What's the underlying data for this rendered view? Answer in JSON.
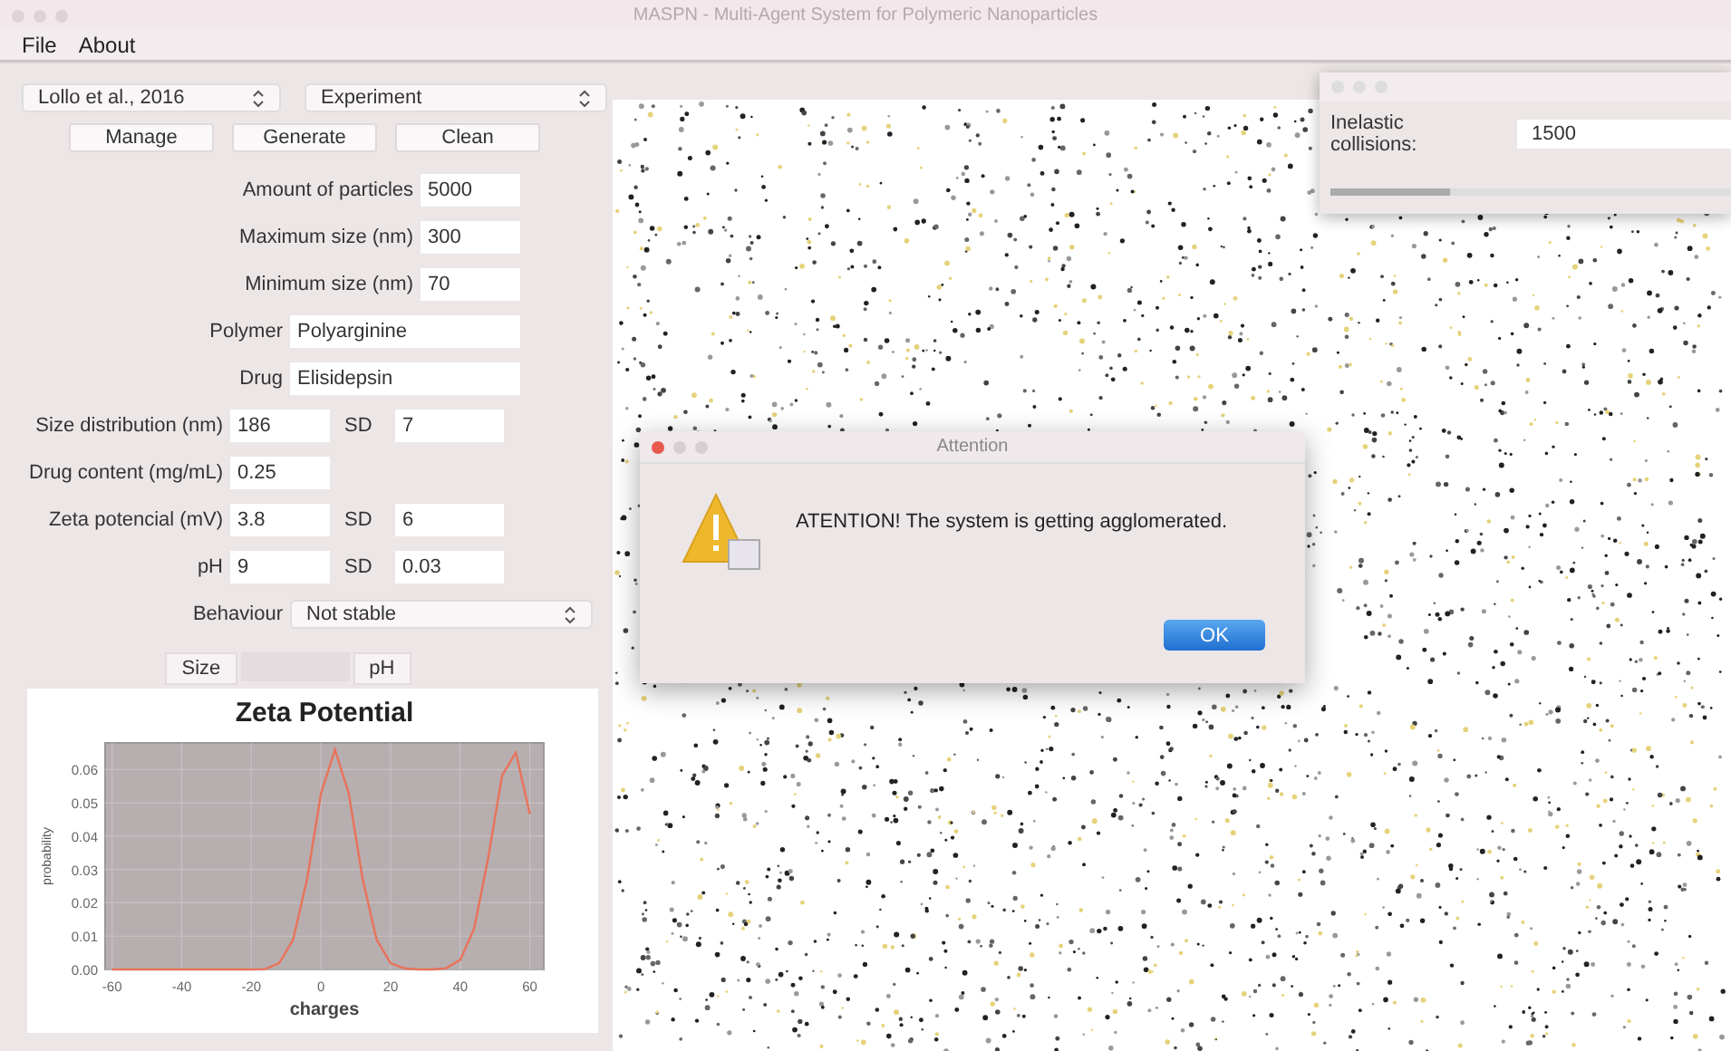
{
  "window": {
    "title": "MASPN - Multi-Agent System for Polymeric Nanoparticles"
  },
  "menu": [
    "File",
    "About"
  ],
  "left_panel": {
    "selectors": [
      {
        "value": "Lollo et al., 2016"
      },
      {
        "value": "Experiment"
      }
    ],
    "buttons": [
      "Manage",
      "Generate",
      "Clean"
    ],
    "fields": [
      {
        "kind": "number",
        "label": "Amount of particles",
        "value": "5000"
      },
      {
        "kind": "number",
        "label": "Maximum size (nm)",
        "value": "300"
      },
      {
        "kind": "number",
        "label": "Minimum size (nm)",
        "value": "70"
      },
      {
        "kind": "text",
        "label": "Polymer",
        "value": "Polyarginine"
      },
      {
        "kind": "text",
        "label": "Drug",
        "value": "Elisidepsin"
      },
      {
        "kind": "pair",
        "label": "Size distribution (nm)",
        "value": "186",
        "sd_label": "SD",
        "sd_value": "7"
      },
      {
        "kind": "single",
        "label": "Drug content (mg/mL)",
        "value": "0.25"
      },
      {
        "kind": "pair",
        "label": "Zeta potencial (mV)",
        "value": "3.8",
        "sd_label": "SD",
        "sd_value": "6"
      },
      {
        "kind": "pair",
        "label": "pH",
        "value": "9",
        "sd_label": "SD",
        "sd_value": "0.03"
      },
      {
        "kind": "select",
        "label": "Behaviour",
        "value": "Not stable"
      }
    ],
    "tabs": [
      {
        "label": "Size",
        "selected": false
      },
      {
        "selected": true
      },
      {
        "label": "pH",
        "selected": false
      }
    ],
    "chart": {
      "chart_data": {
        "type": "line",
        "title": "Zeta Potential",
        "xlabel": "charges",
        "ylabel": "probability",
        "x": [
          -60,
          -56,
          -52,
          -48,
          -44,
          -40,
          -36,
          -32,
          -28,
          -24,
          -20,
          -16,
          -12,
          -8,
          -4,
          0,
          4,
          8,
          12,
          16,
          20,
          24,
          28,
          32,
          36,
          40,
          44,
          48,
          52,
          56,
          60
        ],
        "grid": true,
        "series": [
          {
            "color": "#e8735a",
            "values": [
              0,
              0,
              0,
              0,
              0,
              0,
              0,
              0,
              0,
              0,
              0,
              0.0001,
              0.0019,
              0.0089,
              0.0271,
              0.0529,
              0.066,
              0.0529,
              0.0271,
              0.0089,
              0.0019,
              0.0003,
              0,
              0,
              0.0004,
              0.0029,
              0.0123,
              0.0334,
              0.0582,
              0.0651,
              0.0467
            ]
          }
        ],
        "xlim": [
          -62,
          64
        ],
        "ylim": [
          0,
          0.068
        ],
        "xticks": [
          -60,
          -40,
          -20,
          0,
          20,
          40,
          60
        ],
        "yticks": [
          {
            "value": 0,
            "label": "0.00"
          },
          {
            "value": 0.01,
            "label": "0.01"
          },
          {
            "value": 0.02,
            "label": "0.02"
          },
          {
            "value": 0.03,
            "label": "0.03"
          },
          {
            "value": 0.04,
            "label": "0.04"
          },
          {
            "value": 0.05,
            "label": "0.05"
          },
          {
            "value": 0.06,
            "label": "0.06"
          }
        ]
      }
    }
  },
  "tool_window": {
    "field_label": "Inelastic collisions:",
    "field_value": "1500",
    "progress": {
      "level": 0.3
    }
  },
  "dialog": {
    "title": "Attention",
    "message": "ATENTION! The system is getting agglomerated.",
    "button": "OK"
  }
}
